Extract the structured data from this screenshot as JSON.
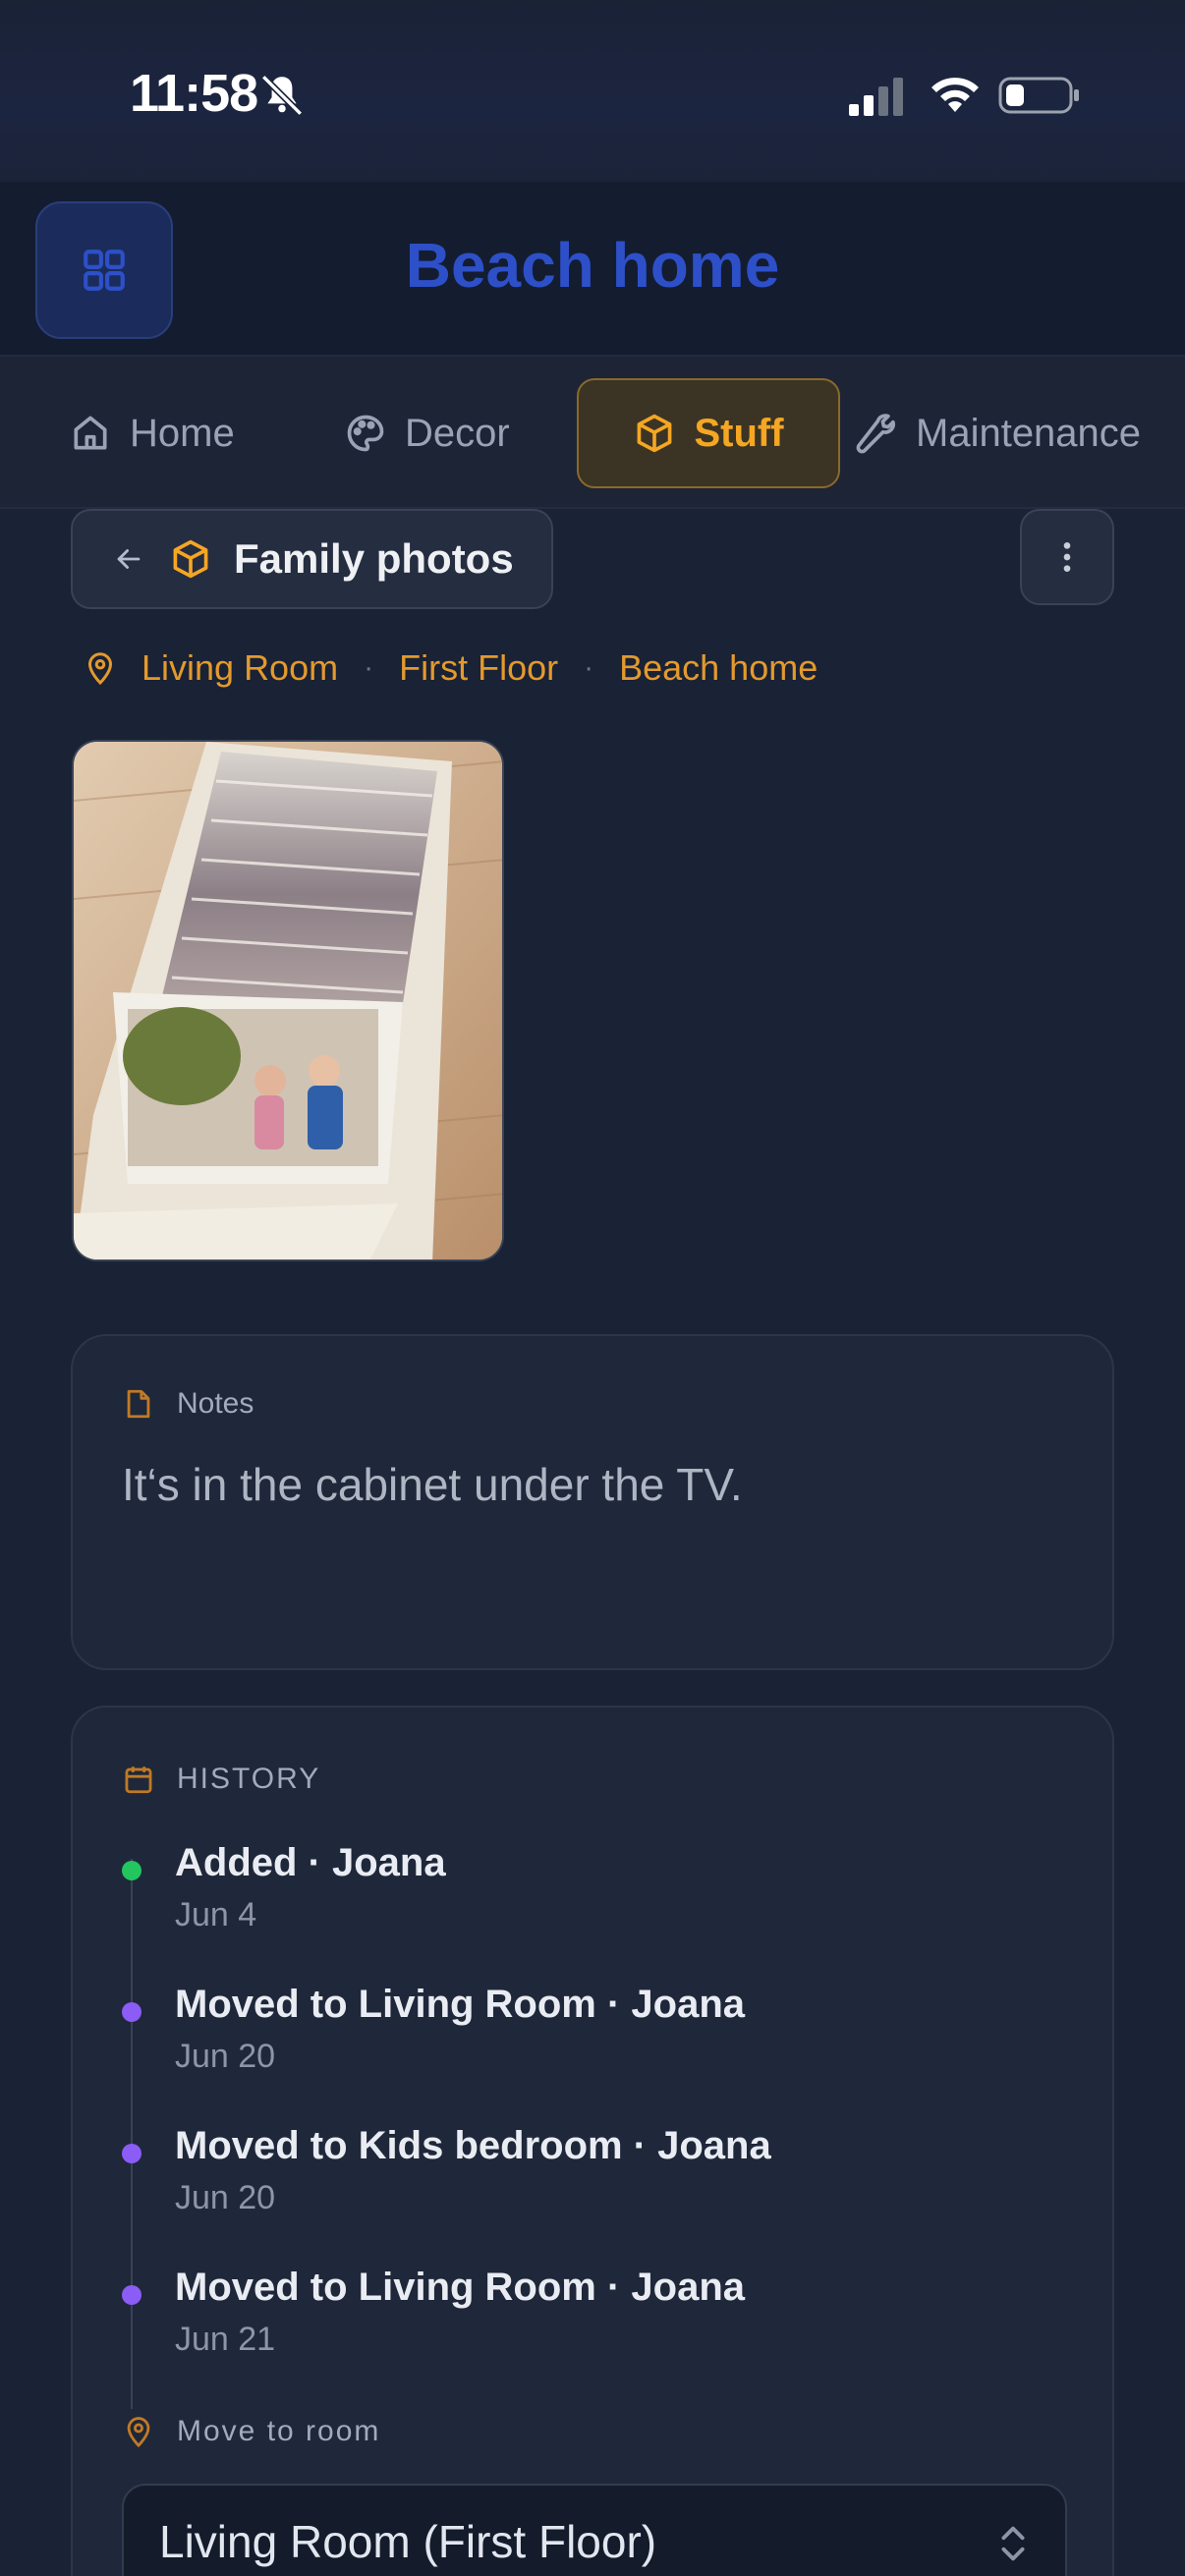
{
  "status": {
    "time": "11:58"
  },
  "header": {
    "title": "Beach home",
    "menu_icon": "grid-icon"
  },
  "tabs": [
    {
      "label": "Home",
      "icon": "house-icon"
    },
    {
      "label": "Decor",
      "icon": "palette-icon"
    },
    {
      "label": "Stuff",
      "icon": "box-icon",
      "active": true
    },
    {
      "label": "Maintenance",
      "icon": "wrench-icon"
    }
  ],
  "item": {
    "title": "Family photos"
  },
  "breadcrumb": {
    "room": "Living Room",
    "floor": "First Floor",
    "home": "Beach home",
    "separator": "·"
  },
  "notes": {
    "label": "Notes",
    "text": "It‘s in the cabinet under the TV."
  },
  "history": {
    "label": "HISTORY",
    "events": [
      {
        "title": "Added · Joana",
        "date": "Jun 4",
        "color": "#22c55e"
      },
      {
        "title": "Moved to Living Room · Joana",
        "date": "Jun 20",
        "color": "#8b5cf6"
      },
      {
        "title": "Moved to Kids bedroom · Joana",
        "date": "Jun 20",
        "color": "#8b5cf6"
      },
      {
        "title": "Moved to Living Room · Joana",
        "date": "Jun 21",
        "color": "#8b5cf6"
      }
    ],
    "move_label": "Move to room",
    "move_value": "Living Room (First Floor)"
  },
  "colors": {
    "accent": "#f5a623",
    "brand": "#2d50c9",
    "background": "#1a2235"
  }
}
